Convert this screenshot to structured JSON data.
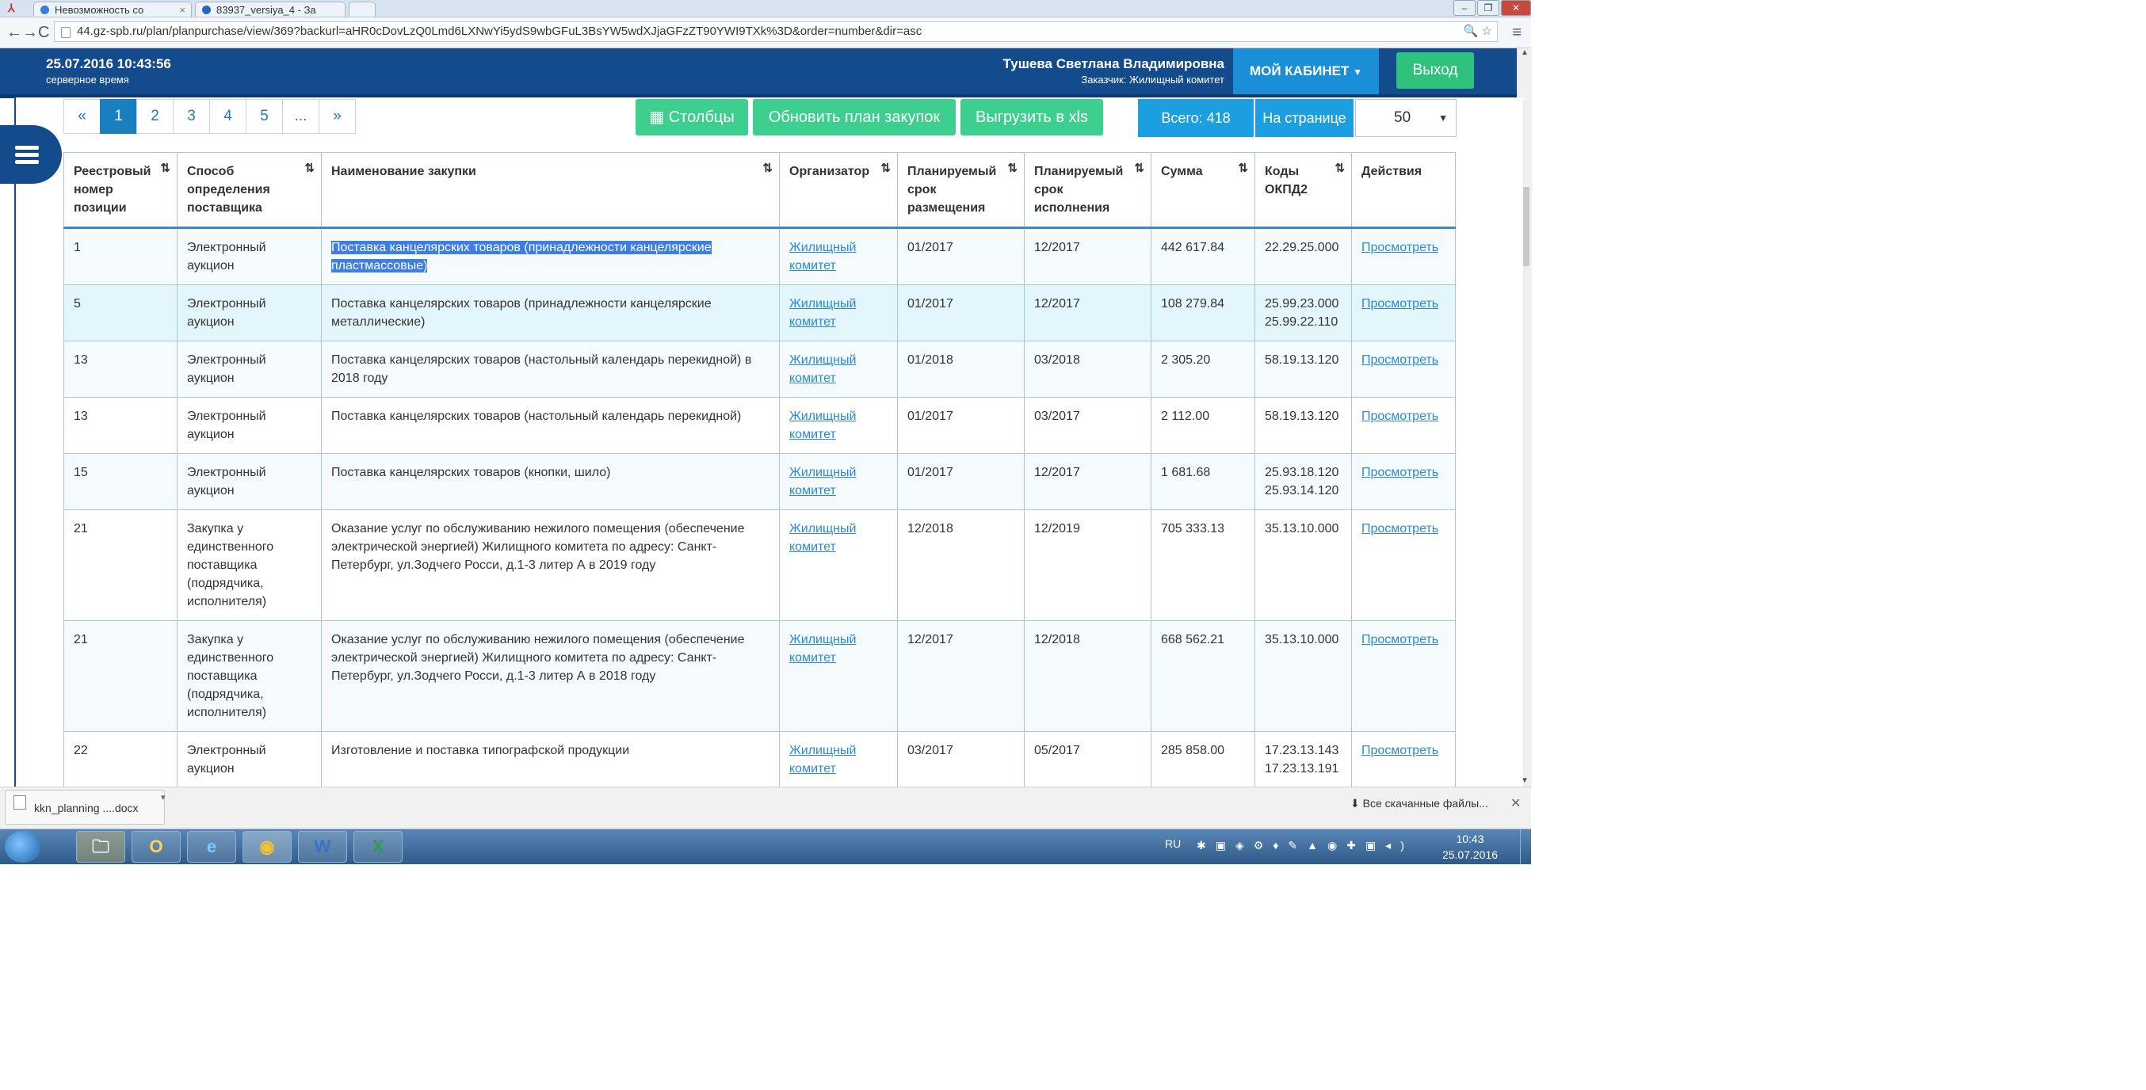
{
  "browser": {
    "tabs": [
      {
        "label": "Невозможность со"
      },
      {
        "label": "83937_versiya_4 - За"
      }
    ],
    "url": "44.gz-spb.ru/plan/planpurchase/view/369?backurl=aHR0cDovLzQ0Lmd6LXNwYi5ydS9wbGFuL3BsYW5wdXJjaGFzZT90YWI9TXk%3D&order=number&dir=asc"
  },
  "header": {
    "datetime": "25.07.2016 10:43:56",
    "time_label": "серверное время",
    "user_name": "Тушева Светлана Владимировна",
    "user_org": "Заказчик: Жилищный комитет",
    "cabinet_label": "МОЙ КАБИНЕТ",
    "logout_label": "Выход"
  },
  "pagination": {
    "items": [
      "«",
      "1",
      "2",
      "3",
      "4",
      "5",
      "...",
      "»"
    ],
    "active": "1"
  },
  "toolbar": {
    "columns_label": "Столбцы",
    "update_label": "Обновить план закупок",
    "export_label": "Выгрузить в xls",
    "total_label": "Всего: 418",
    "perpage_label": "На странице",
    "perpage_value": "50"
  },
  "table": {
    "headers": [
      "Реестровый номер позиции",
      "Способ определения поставщика",
      "Наименование закупки",
      "Организатор",
      "Планируемый срок размещения",
      "Планируемый срок исполнения",
      "Сумма",
      "Коды ОКПД2",
      "Действия"
    ],
    "rows": [
      {
        "num": "1",
        "method": "Электронный аукцион",
        "name": "Поставка канцелярских товаров (принадлежности канцелярские пластмассовые)",
        "org": "Жилищный комитет",
        "placement": "01/2017",
        "execution": "12/2017",
        "sum": "442 617.84",
        "codes": "22.29.25.000",
        "action": "Просмотреть"
      },
      {
        "num": "5",
        "method": "Электронный аукцион",
        "name": "Поставка канцелярских товаров (принадлежности канцелярские металлические)",
        "org": "Жилищный комитет",
        "placement": "01/2017",
        "execution": "12/2017",
        "sum": "108 279.84",
        "codes": "25.99.23.000 25.99.22.110",
        "action": "Просмотреть"
      },
      {
        "num": "13",
        "method": "Электронный аукцион",
        "name": "Поставка канцелярских товаров (настольный календарь перекидной) в 2018 году",
        "org": "Жилищный комитет",
        "placement": "01/2018",
        "execution": "03/2018",
        "sum": "2 305.20",
        "codes": "58.19.13.120",
        "action": "Просмотреть"
      },
      {
        "num": "13",
        "method": "Электронный аукцион",
        "name": "Поставка канцелярских товаров (настольный календарь перекидной)",
        "org": "Жилищный комитет",
        "placement": "01/2017",
        "execution": "03/2017",
        "sum": "2 112.00",
        "codes": "58.19.13.120",
        "action": "Просмотреть"
      },
      {
        "num": "15",
        "method": "Электронный аукцион",
        "name": "Поставка канцелярских товаров (кнопки, шило)",
        "org": "Жилищный комитет",
        "placement": "01/2017",
        "execution": "12/2017",
        "sum": "1 681.68",
        "codes": "25.93.18.120 25.93.14.120",
        "action": "Просмотреть"
      },
      {
        "num": "21",
        "method": "Закупка у единственного поставщика (подрядчика, исполнителя)",
        "name": "Оказание услуг по обслуживанию нежилого помещения (обеспечение электрической энергией) Жилищного комитета по адресу: Санкт-Петербург, ул.Зодчего Росси, д.1-3 литер А в 2019 году",
        "org": "Жилищный комитет",
        "placement": "12/2018",
        "execution": "12/2019",
        "sum": "705 333.13",
        "codes": "35.13.10.000",
        "action": "Просмотреть"
      },
      {
        "num": "21",
        "method": "Закупка у единственного поставщика (подрядчика, исполнителя)",
        "name": "Оказание услуг по обслуживанию нежилого помещения (обеспечение электрической энергией) Жилищного комитета по адресу: Санкт-Петербург, ул.Зодчего Росси, д.1-3 литер А в 2018 году",
        "org": "Жилищный комитет",
        "placement": "12/2017",
        "execution": "12/2018",
        "sum": "668 562.21",
        "codes": "35.13.10.000",
        "action": "Просмотреть"
      },
      {
        "num": "22",
        "method": "Электронный аукцион",
        "name": "Изготовление и поставка типографской продукции",
        "org": "Жилищный комитет",
        "placement": "03/2017",
        "execution": "05/2017",
        "sum": "285 858.00",
        "codes": "17.23.13.143 17.23.13.191",
        "action": "Просмотреть"
      }
    ]
  },
  "downloads": {
    "file_name": "kkn_planning ....docx",
    "show_all": "Все скачанные файлы..."
  },
  "taskbar": {
    "lang": "RU",
    "time": "10:43",
    "date": "25.07.2016"
  }
}
